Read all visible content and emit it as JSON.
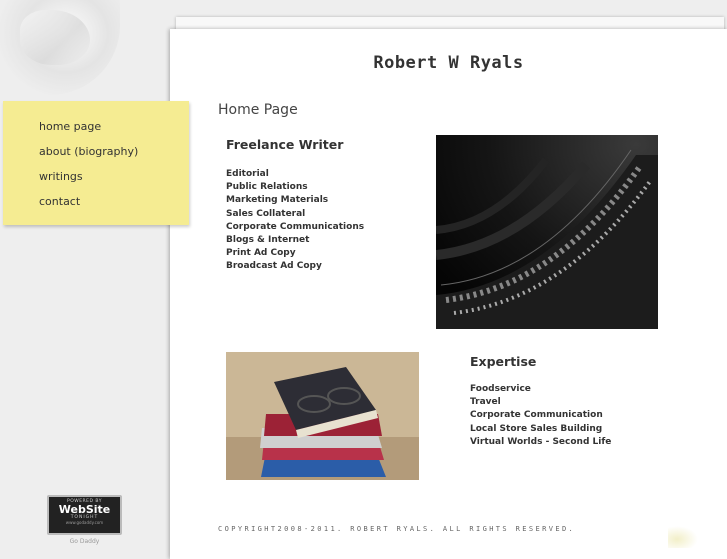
{
  "site": {
    "title": "Robert W Ryals"
  },
  "nav": {
    "items": [
      {
        "label": "home page"
      },
      {
        "label": "about (biography)"
      },
      {
        "label": "writings"
      },
      {
        "label": "contact"
      }
    ]
  },
  "main": {
    "heading": "Home Page",
    "freelance": {
      "title": "Freelance Writer",
      "items": [
        "Editorial",
        "Public Relations",
        "Marketing Materials",
        "Sales Collateral",
        "Corporate Communications",
        "Blogs & Internet",
        "Print Ad Copy",
        "Broadcast Ad Copy"
      ]
    },
    "expertise": {
      "title": "Expertise",
      "items": [
        "Foodservice",
        "Travel",
        "Corporate Communication",
        "Local Store Sales Building",
        "Virtual Worlds - Second Life"
      ]
    }
  },
  "footer": {
    "copyright": "COPYRIGHT2008-2011. ROBERT RYALS. ALL RIGHTS RESERVED."
  },
  "badge": {
    "top": "POWERED BY",
    "main": "WebSite",
    "sub": "TONIGHT",
    "url": "www.godaddy.com",
    "caption": "Go Daddy"
  },
  "colors": {
    "sticky_note": "#f5ec92",
    "page": "#ffffff",
    "background": "#eeeeee"
  }
}
